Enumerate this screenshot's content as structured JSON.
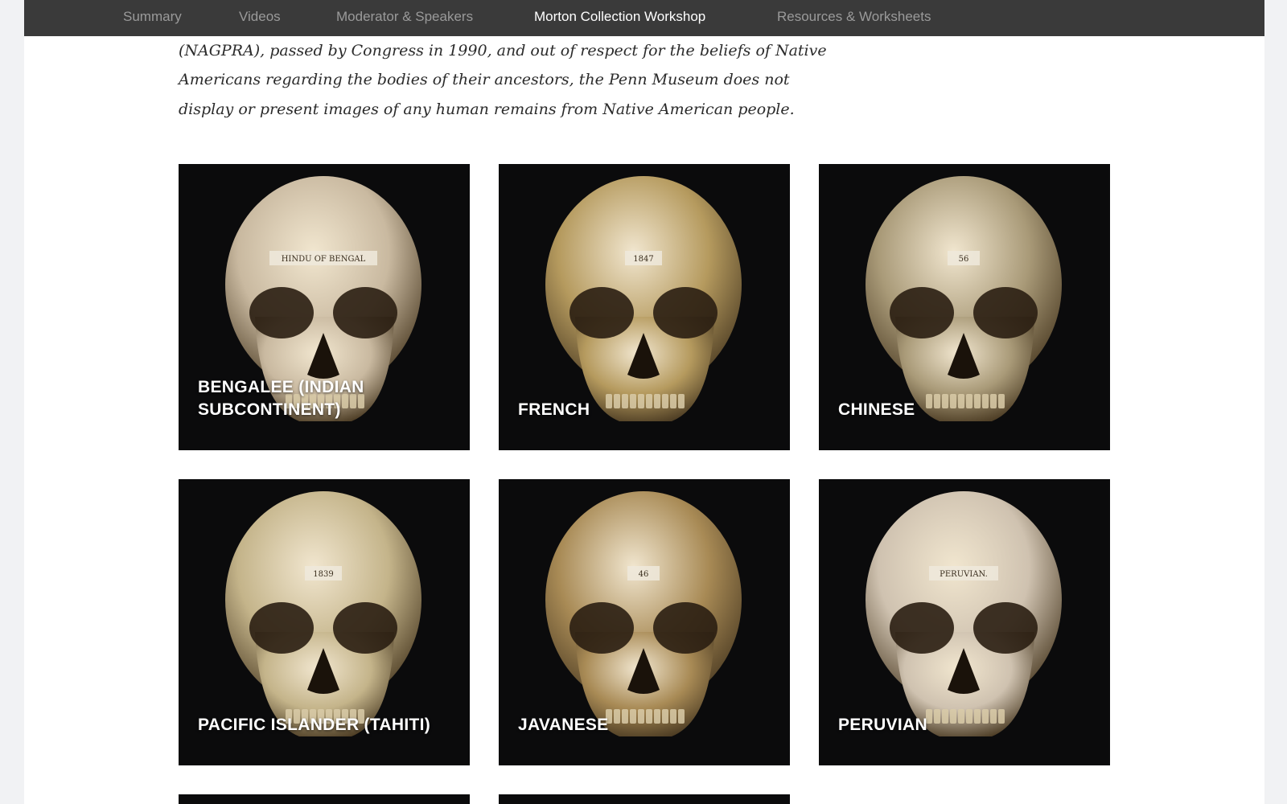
{
  "nav": {
    "items": [
      {
        "label": "Summary",
        "active": false
      },
      {
        "label": "Videos",
        "active": false
      },
      {
        "label": "Moderator & Speakers",
        "active": false
      },
      {
        "label": "Morton Collection Workshop",
        "active": true
      },
      {
        "label": "Resources & Worksheets",
        "active": false
      }
    ]
  },
  "intro_text": "In accordance with the Native American Grave Protection and Repatriation Act (NAGPRA), passed by Congress in 1990, and out of respect for the beliefs of Native Americans regarding the bodies of their ancestors, the Penn Museum does not display or present images of any human remains from Native American people.",
  "gallery": {
    "tiles": [
      {
        "label": "Bengalee (Indian Subcontinent)",
        "image": "skull-photo",
        "specimen_label": "HINDU OF BENGAL",
        "tone": "#c9b9a0"
      },
      {
        "label": "French",
        "image": "skull-photo",
        "specimen_label": "1847",
        "tone": "#b59a5e"
      },
      {
        "label": "Chinese",
        "image": "skull-photo",
        "specimen_label": "56",
        "tone": "#a99a78"
      },
      {
        "label": "Pacific Islander (Tahiti)",
        "image": "skull-photo",
        "specimen_label": "1839",
        "tone": "#c4b48a"
      },
      {
        "label": "Javanese",
        "image": "skull-photo",
        "specimen_label": "46",
        "tone": "#a88a55"
      },
      {
        "label": "Peruvian",
        "image": "skull-photo",
        "specimen_label": "PERUVIAN.",
        "tone": "#cfc2b0"
      }
    ]
  },
  "colors": {
    "nav_bg": "#3a3a3a",
    "nav_active": "#ffffff",
    "nav_inactive": "#9a9a9a",
    "tile_bg": "#0b0b0c"
  }
}
